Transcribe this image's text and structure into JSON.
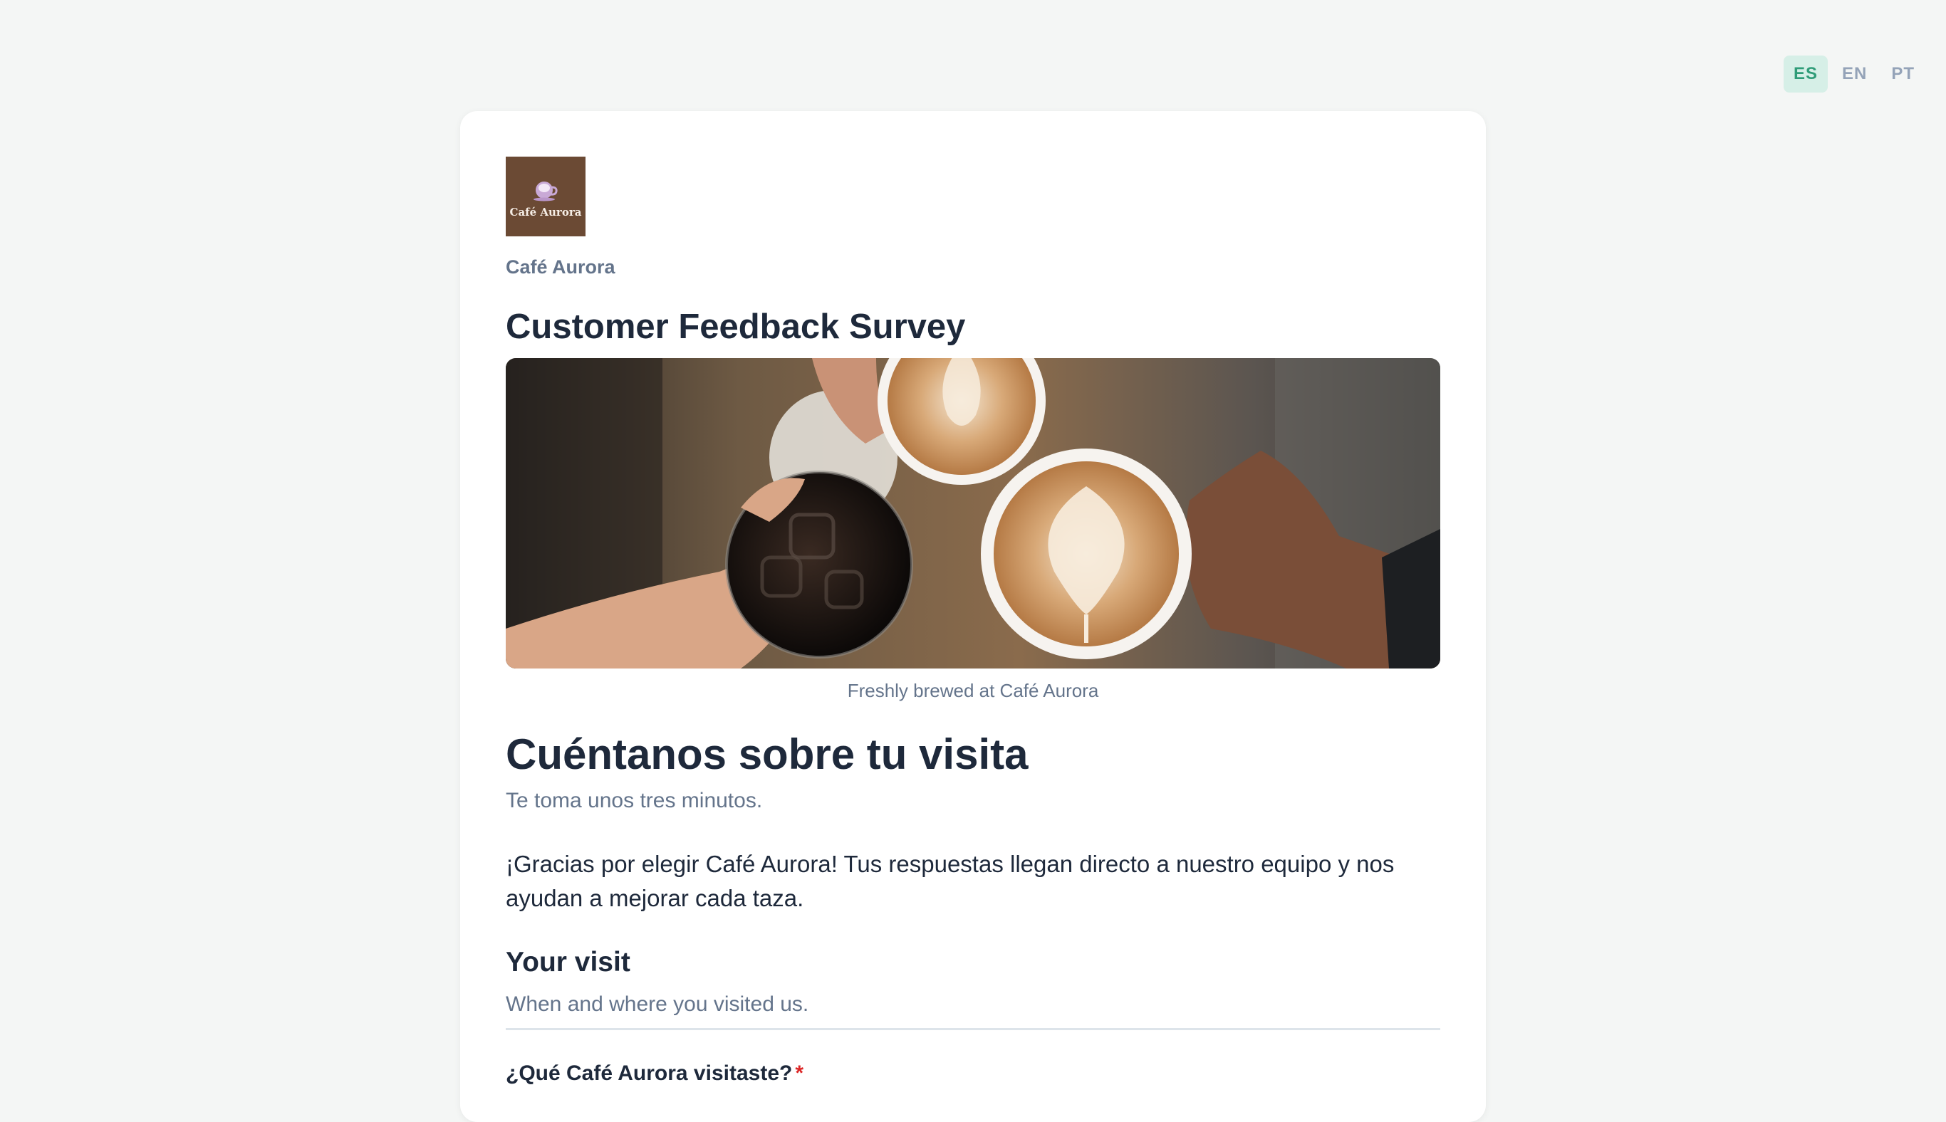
{
  "languages": [
    {
      "code": "ES",
      "active": true
    },
    {
      "code": "EN",
      "active": false
    },
    {
      "code": "PT",
      "active": false
    }
  ],
  "brand": {
    "logo_text": "Café Aurora",
    "name": "Café Aurora",
    "color": "#6b4a34"
  },
  "survey": {
    "title": "Customer Feedback Survey",
    "hero_caption": "Freshly brewed at Café Aurora"
  },
  "section": {
    "heading": "Cuéntanos sobre tu visita",
    "subtitle": "Te toma unos tres minutos.",
    "intro": "¡Gracias por elegir Café Aurora! Tus respuestas llegan directo a nuestro equipo y nos ayudan a mejorar cada taza."
  },
  "group": {
    "title": "Your visit",
    "description": "When and where you visited us."
  },
  "question": {
    "label": "¿Qué Café Aurora visitaste?",
    "required_mark": "*"
  },
  "colors": {
    "accent": "#2f9c78",
    "required": "#dc2626"
  }
}
